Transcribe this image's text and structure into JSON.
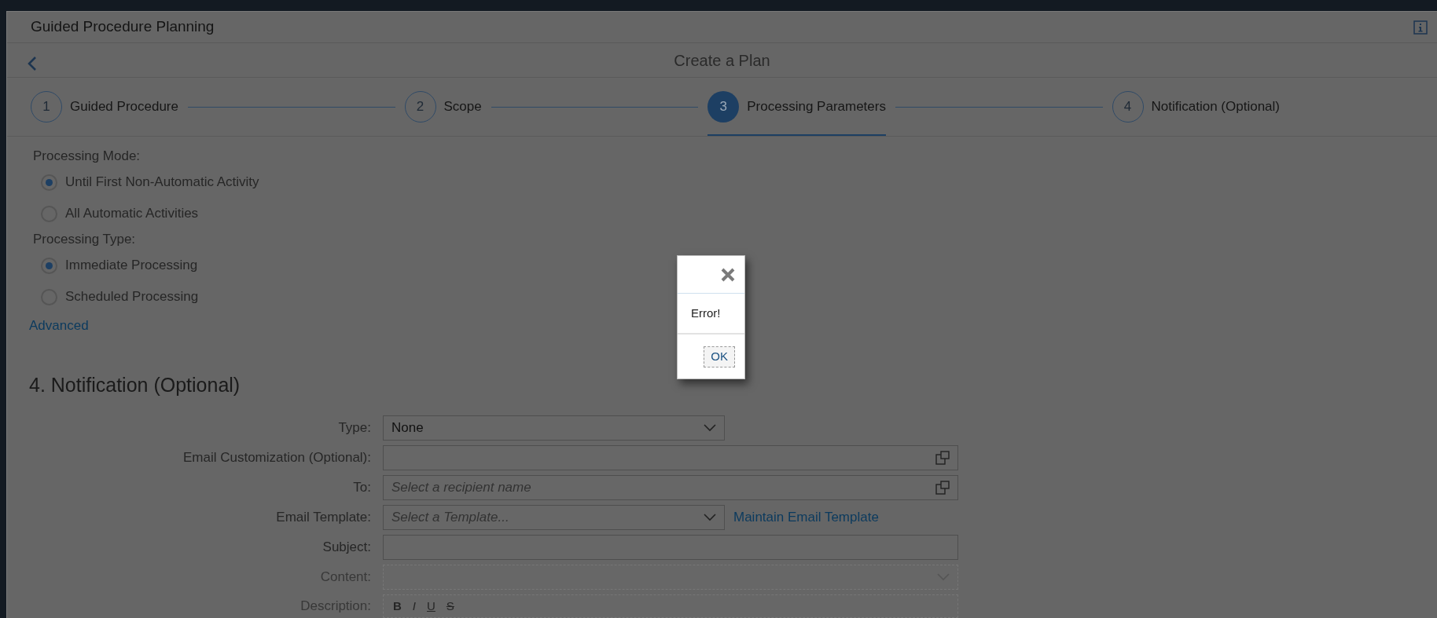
{
  "window": {
    "title": "Guided Procedure Planning"
  },
  "nav": {
    "title": "Create a Plan"
  },
  "steps": [
    {
      "number": "1",
      "label": "Guided Procedure",
      "selected": false
    },
    {
      "number": "2",
      "label": "Scope",
      "selected": false
    },
    {
      "number": "3",
      "label": "Processing Parameters",
      "selected": true
    },
    {
      "number": "4",
      "label": "Notification (Optional)",
      "selected": false
    }
  ],
  "processing_mode": {
    "label": "Processing Mode:",
    "options": [
      {
        "label": "Until First Non-Automatic Activity",
        "selected": true
      },
      {
        "label": "All Automatic Activities",
        "selected": false
      }
    ]
  },
  "processing_type": {
    "label": "Processing Type:",
    "options": [
      {
        "label": "Immediate Processing",
        "selected": true
      },
      {
        "label": "Scheduled Processing",
        "selected": false
      }
    ]
  },
  "advanced_link": "Advanced",
  "notification": {
    "heading": "4. Notification (Optional)",
    "fields": [
      {
        "label": "Type:",
        "kind": "select",
        "value": "None",
        "disabled": false
      },
      {
        "label": "Email Customization (Optional):",
        "kind": "value-help",
        "disabled": false
      },
      {
        "label": "To:",
        "kind": "value-help",
        "placeholder": "Select a recipient name",
        "disabled": false
      },
      {
        "label": "Email Template:",
        "kind": "select",
        "placeholder": "Select a Template...",
        "link": "Maintain Email Template",
        "disabled": false
      },
      {
        "label": "Subject:",
        "kind": "text",
        "disabled": false
      },
      {
        "label": "Content:",
        "kind": "wide-select",
        "disabled": true
      },
      {
        "label": "Description:",
        "kind": "rich-text",
        "toolbar": [
          "B",
          "I",
          "U",
          "S"
        ],
        "disabled": true
      }
    ]
  },
  "dialog": {
    "message": "Error!",
    "button": "OK"
  }
}
